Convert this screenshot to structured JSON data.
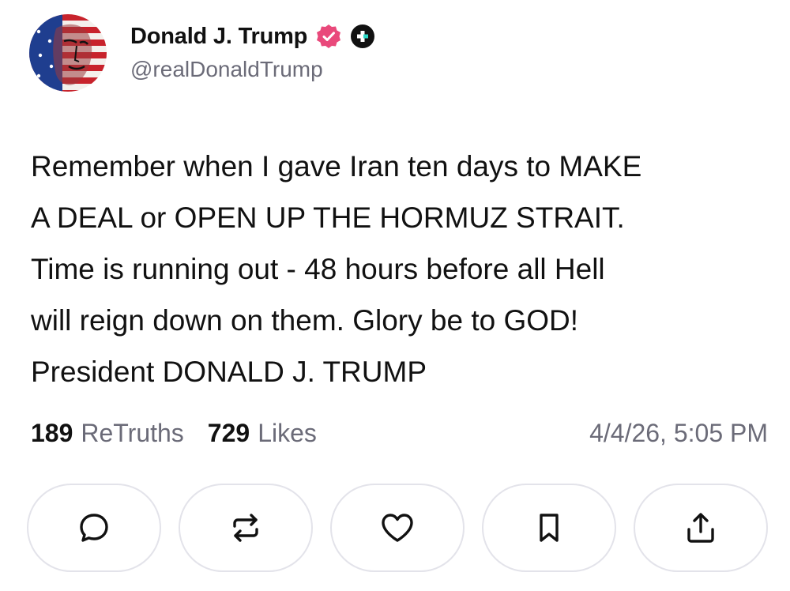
{
  "author": {
    "display_name": "Donald J. Trump",
    "handle": "@realDonaldTrump",
    "verified_icon": "verified-badge-icon",
    "plus_icon": "plus-badge-icon",
    "accent_color": "#e9497b"
  },
  "post": {
    "lines": [
      "Remember when I gave Iran ten days to MAKE",
      "A DEAL or OPEN UP THE HORMUZ STRAIT.",
      "Time is running out - 48 hours before all Hell",
      "will reign down on them. Glory be to GOD!",
      "President DONALD J. TRUMP"
    ]
  },
  "stats": {
    "retruths_count": "189",
    "retruths_label": "ReTruths",
    "likes_count": "729",
    "likes_label": "Likes",
    "timestamp": "4/4/26, 5:05 PM"
  },
  "actions": [
    {
      "name": "reply",
      "icon": "comment-icon"
    },
    {
      "name": "retruth",
      "icon": "repost-icon"
    },
    {
      "name": "like",
      "icon": "heart-icon"
    },
    {
      "name": "bookmark",
      "icon": "bookmark-icon"
    },
    {
      "name": "share",
      "icon": "share-icon"
    }
  ],
  "colors": {
    "text": "#111111",
    "muted": "#6b6b78",
    "button_border": "#e3e3ea"
  }
}
